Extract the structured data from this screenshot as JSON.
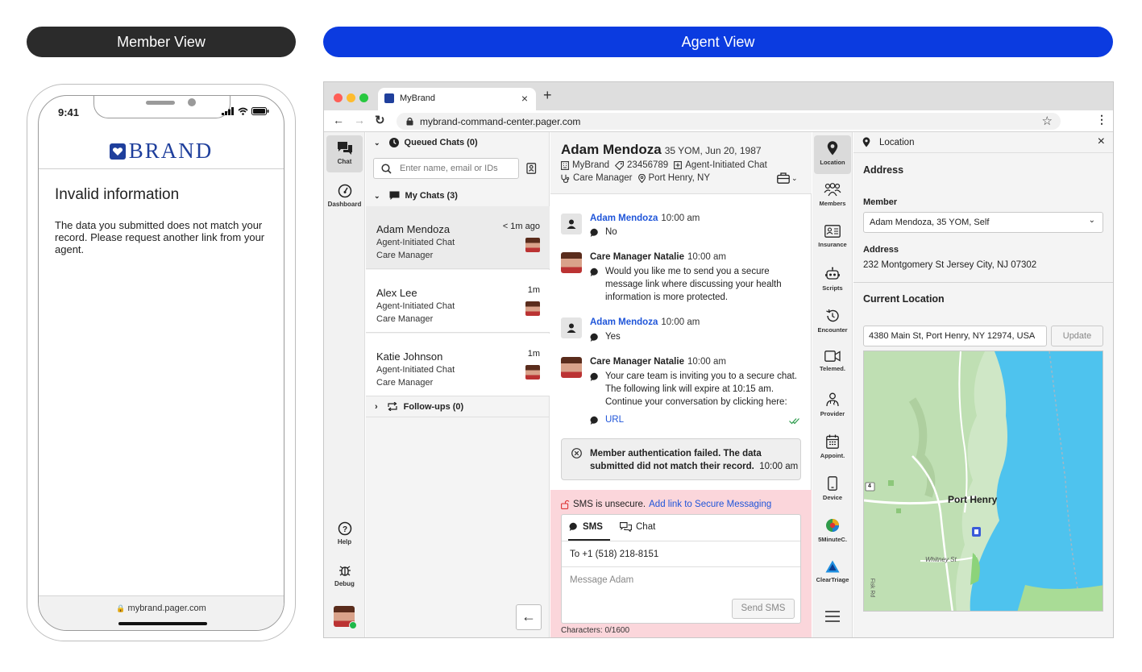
{
  "banners": {
    "member": "Member View",
    "agent": "Agent View"
  },
  "phone": {
    "time": "9:41",
    "brand_word": "BRAND",
    "title": "Invalid information",
    "body": "The data you submitted does not match your record. Please request another link from your agent.",
    "url": "mybrand.pager.com"
  },
  "browser": {
    "tab_title": "MyBrand",
    "url": "mybrand-command-center.pager.com"
  },
  "nav": {
    "items": [
      {
        "label": "Chat",
        "icon": "chat-bubbles-icon"
      },
      {
        "label": "Dashboard",
        "icon": "gauge-icon"
      },
      {
        "label": "Help",
        "icon": "help-icon"
      },
      {
        "label": "Debug",
        "icon": "bug-icon"
      }
    ]
  },
  "chatlist": {
    "queued": "Queued Chats (0)",
    "search_placeholder": "Enter name, email or IDs",
    "my_chats": "My Chats (3)",
    "followups": "Follow-ups (0)",
    "chats": [
      {
        "name": "Adam Mendoza",
        "line1": "Agent-Initiated Chat",
        "line2": "Care Manager",
        "time": "< 1m ago"
      },
      {
        "name": "Alex Lee",
        "line1": "Agent-Initiated Chat",
        "line2": "Care Manager",
        "time": "1m"
      },
      {
        "name": "Katie Johnson",
        "line1": "Agent-Initiated Chat",
        "line2": "Care Manager",
        "time": "1m"
      }
    ]
  },
  "conversation": {
    "name": "Adam Mendoza",
    "meta": "35 YOM, Jun 20, 1987",
    "brand": "MyBrand",
    "id": "23456789",
    "chat_type": "Agent-Initiated Chat",
    "role": "Care Manager",
    "location": "Port Henry, NY",
    "messages": [
      {
        "author": "Adam Mendoza",
        "time": "10:00 am",
        "text": "No"
      },
      {
        "author": "Care Manager Natalie",
        "time": "10:00 am",
        "text": "Would you like me to send you a secure message link where discussing your health information is more protected."
      },
      {
        "author": "Adam Mendoza",
        "time": "10:00 am",
        "text": "Yes"
      },
      {
        "author": "Care Manager Natalie",
        "time": "10:00 am",
        "text": "Your care team is inviting you to a secure chat. The following link will expire at 10:15 am. Continue your conversation by clicking here:",
        "link": "URL"
      }
    ],
    "auth_text": "Member authentication failed. The data submitted did not match their record.",
    "auth_time": "10:00 am"
  },
  "composer": {
    "warning": "SMS is unsecure.",
    "warning_link": "Add link to Secure Messaging",
    "tab_sms": "SMS",
    "tab_chat": "Chat",
    "to": "To  +1 (518) 218-8151",
    "placeholder": "Message Adam",
    "send_label": "Send SMS",
    "characters": "Characters: 0/1600"
  },
  "tools": [
    {
      "label": "Location",
      "icon": "location-pin-icon"
    },
    {
      "label": "Members",
      "icon": "members-icon"
    },
    {
      "label": "Insurance",
      "icon": "id-card-icon"
    },
    {
      "label": "Scripts",
      "icon": "robot-icon"
    },
    {
      "label": "Encounter",
      "icon": "history-icon"
    },
    {
      "label": "Telemed.",
      "icon": "video-camera-icon"
    },
    {
      "label": "Provider",
      "icon": "provider-icon"
    },
    {
      "label": "Appoint.",
      "icon": "calendar-icon"
    },
    {
      "label": "Device",
      "icon": "phone-device-icon"
    },
    {
      "label": "5MinuteC.",
      "icon": "five-minute-consult-icon"
    },
    {
      "label": "ClearTriage",
      "icon": "cleartriage-icon"
    }
  ],
  "panel": {
    "title": "Location",
    "address_heading": "Address",
    "member_label": "Member",
    "member_value": "Adam Mendoza, 35 YOM, Self",
    "address_label": "Address",
    "address_value": "232 Montgomery St Jersey City, NJ 07302",
    "current_location_heading": "Current Location",
    "current_location_value": "4380 Main St, Port Henry, NY 12974, USA",
    "update_label": "Update",
    "map_city": "Port Henry",
    "map_street": "Whitney St",
    "map_road": "Fisk Rd",
    "map_route": "4"
  }
}
